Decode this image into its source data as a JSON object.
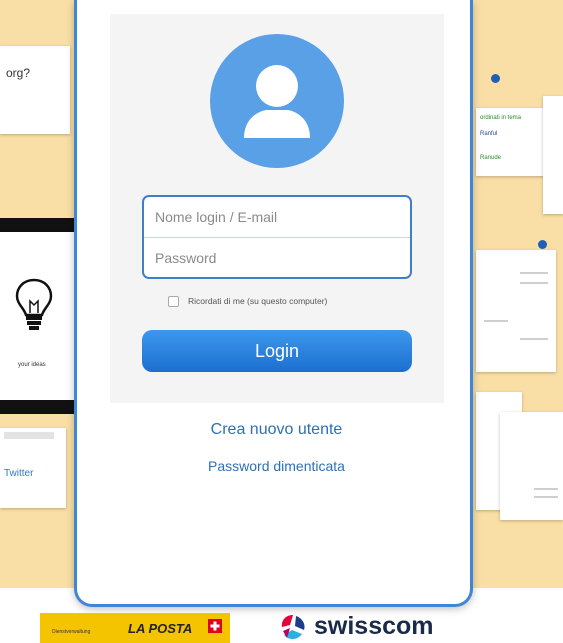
{
  "colors": {
    "background": "#f9dfa5",
    "modal_border": "#3e86d6",
    "button": "#1c6fd0",
    "link": "#2e6fb6",
    "avatar": "#5aa0e6"
  },
  "background": {
    "card_question": "org?",
    "card_twitter": "Twitter",
    "card_ideas": "your ideas",
    "note_line1": "ordinati in tema",
    "note_line2": "Ranful",
    "note_line3": "Ranude"
  },
  "login": {
    "avatar_icon": "user-icon",
    "username_placeholder": "Nome login / E-mail",
    "password_placeholder": "Password",
    "remember_label": "Ricordati di me (su questo computer)",
    "login_button": "Login",
    "create_user_link": "Crea nuovo utente",
    "forgot_password_link": "Password dimenticata"
  },
  "footer": {
    "laposta_name": "LA POSTA",
    "laposta_tagline": "Dienstverwaltung",
    "swisscom_name": "swisscom"
  }
}
